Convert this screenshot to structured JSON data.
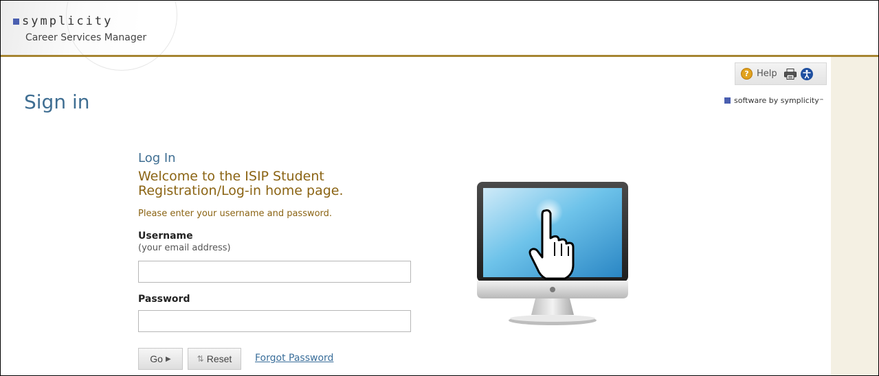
{
  "header": {
    "brand_name": "symplicity",
    "brand_subtitle": "Career Services Manager"
  },
  "toolbar": {
    "help_label": "Help",
    "help_icon": "help-icon",
    "print_icon": "print-icon",
    "accessibility_icon": "accessibility-icon"
  },
  "software_by": {
    "text": "software by symplicity",
    "trademark": "™"
  },
  "page": {
    "title": "Sign in"
  },
  "login": {
    "heading": "Log In",
    "welcome": "Welcome to the ISIP Student Registration/Log-in home page.",
    "instructions": "Please enter your username and password.",
    "username_label": "Username",
    "username_hint": "(your email address)",
    "username_value": "",
    "password_label": "Password",
    "password_value": "",
    "go_label": "Go",
    "reset_label": "Reset",
    "forgot_password_label": "Forgot Password"
  },
  "colors": {
    "accent_gold": "#a68531",
    "title_blue": "#3f6e92",
    "welcome_brown": "#8b6414",
    "link_blue": "#3a6e9a",
    "sidebar_cream": "#f4f0e3"
  }
}
